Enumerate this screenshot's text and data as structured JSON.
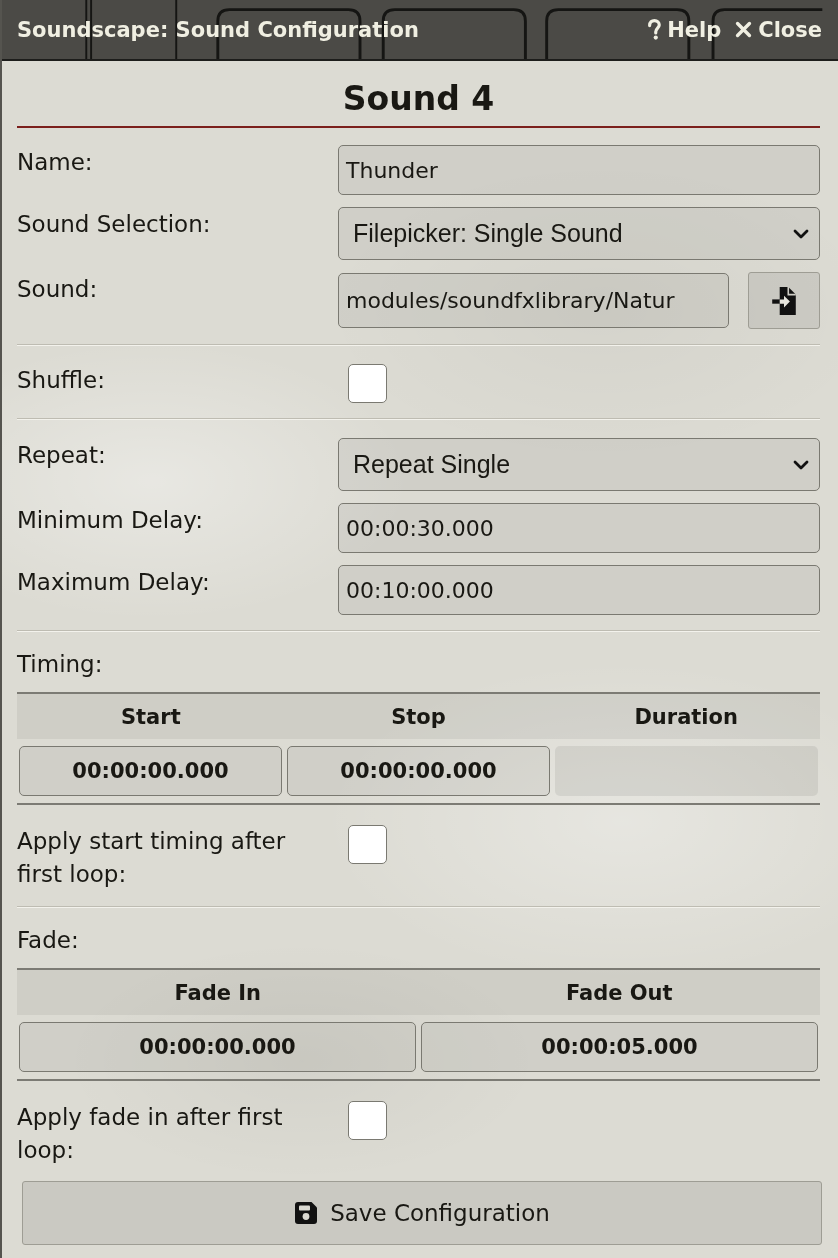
{
  "window": {
    "title": "Soundscape: Sound Configuration",
    "buttons": [
      {
        "kind": "help",
        "label": "Help"
      },
      {
        "kind": "close",
        "label": "Close"
      }
    ]
  },
  "heading": "Sound 4",
  "sections": [
    {
      "rows": [
        {
          "kind": "text",
          "label": "Name:",
          "value": "Thunder"
        },
        {
          "kind": "select",
          "label": "Sound Selection:",
          "value": "Filepicker: Single Sound"
        },
        {
          "kind": "file",
          "label": "Sound:",
          "value": "modules/soundfxlibrary/Natur"
        }
      ]
    },
    {
      "rows": [
        {
          "kind": "checkbox",
          "label": "Shuffle:",
          "checked": false
        }
      ]
    },
    {
      "rows": [
        {
          "kind": "select",
          "label": "Repeat:",
          "value": "Repeat Single"
        },
        {
          "kind": "text",
          "label": "Minimum Delay:",
          "value": "00:00:30.000"
        },
        {
          "kind": "text",
          "label": "Maximum Delay:",
          "value": "00:10:00.000"
        }
      ]
    },
    {
      "title": "Timing:",
      "table": {
        "columns": [
          "Start",
          "Stop",
          "Duration"
        ],
        "cells": [
          {
            "value": "00:00:00.000",
            "disabled": false
          },
          {
            "value": "00:00:00.000",
            "disabled": false
          },
          {
            "disabled": true
          }
        ]
      },
      "rows": [
        {
          "kind": "checkbox",
          "label": "Apply start timing after first loop:",
          "checked": false
        }
      ]
    },
    {
      "title": "Fade:",
      "table": {
        "columns": [
          "Fade In",
          "Fade Out"
        ],
        "cells": [
          {
            "value": "00:00:00.000",
            "disabled": false
          },
          {
            "value": "00:00:05.000",
            "disabled": false
          }
        ]
      },
      "rows": [
        {
          "kind": "checkbox",
          "label": "Apply fade in after first loop:",
          "checked": false
        }
      ]
    }
  ],
  "save_button": {
    "label": "Save Configuration"
  }
}
